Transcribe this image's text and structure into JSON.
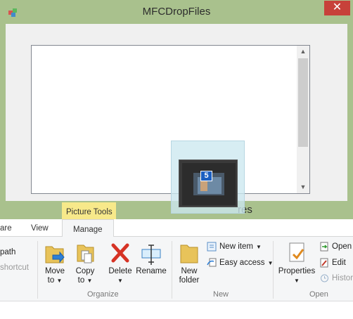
{
  "dialog": {
    "title": "MFCDropFiles"
  },
  "drag": {
    "count": "5"
  },
  "explorer": {
    "title_fragment": "res",
    "context_tab": "Picture Tools",
    "tabs": [
      "are",
      "View",
      "Manage"
    ],
    "ribbon": {
      "clipboard_fragments": {
        "path": "path",
        "shortcut": "shortcut"
      },
      "organize": {
        "label": "Organize",
        "move_to": {
          "line1": "Move",
          "line2": "to"
        },
        "copy_to": {
          "line1": "Copy",
          "line2": "to"
        },
        "delete": "Delete",
        "rename": "Rename"
      },
      "new": {
        "label": "New",
        "new_folder": {
          "line1": "New",
          "line2": "folder"
        },
        "new_item": "New item",
        "easy_access": "Easy access"
      },
      "open": {
        "label": "Open",
        "properties": "Properties",
        "open": "Open",
        "edit": "Edit",
        "history": "Histor"
      }
    }
  },
  "colors": {
    "titlebar": "#a9c18d",
    "close": "#c7413a",
    "context_tab": "#f7e98a",
    "ribbon_bg": "#f5f6f7",
    "drag_overlay": "#cce8f0",
    "badge": "#1c5fc0"
  }
}
